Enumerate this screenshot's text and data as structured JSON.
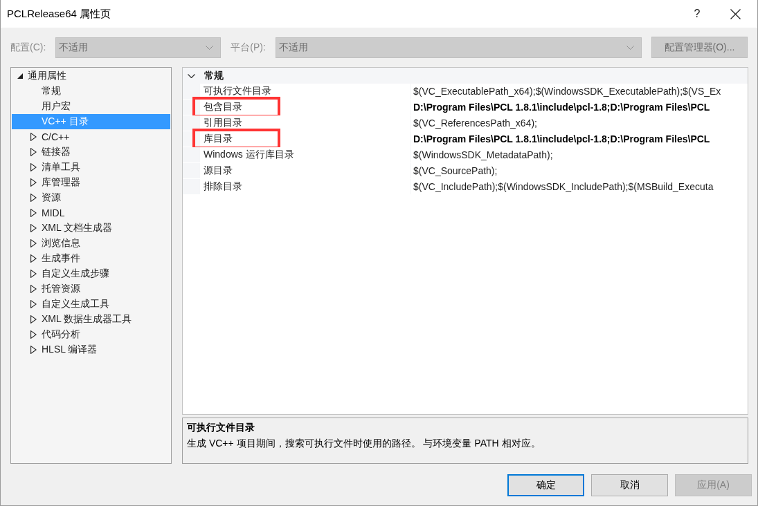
{
  "window": {
    "title": "PCLRelease64 属性页",
    "help_button": "?"
  },
  "config_bar": {
    "configuration": {
      "label": "配置(C):",
      "value": "不适用",
      "disabled": true
    },
    "platform": {
      "label": "平台(P):",
      "value": "不适用",
      "disabled": true
    },
    "manager_button": {
      "label": "配置管理器(O)...",
      "disabled": true
    }
  },
  "sidebar": {
    "items": [
      {
        "label": "通用属性",
        "expanded": true,
        "selected": false,
        "children": [
          {
            "label": "常规",
            "selected": false
          },
          {
            "label": "用户宏",
            "selected": false
          },
          {
            "label": "VC++ 目录",
            "selected": true
          }
        ]
      },
      {
        "label": "C/C++",
        "expanded": false,
        "selected": false
      },
      {
        "label": "链接器",
        "expanded": false,
        "selected": false
      },
      {
        "label": "清单工具",
        "expanded": false,
        "selected": false
      },
      {
        "label": "库管理器",
        "expanded": false,
        "selected": false
      },
      {
        "label": "资源",
        "expanded": false,
        "selected": false
      },
      {
        "label": "MIDL",
        "expanded": false,
        "selected": false
      },
      {
        "label": "XML 文档生成器",
        "expanded": false,
        "selected": false
      },
      {
        "label": "浏览信息",
        "expanded": false,
        "selected": false
      },
      {
        "label": "生成事件",
        "expanded": false,
        "selected": false
      },
      {
        "label": "自定义生成步骤",
        "expanded": false,
        "selected": false
      },
      {
        "label": "托管资源",
        "expanded": false,
        "selected": false
      },
      {
        "label": "自定义生成工具",
        "expanded": false,
        "selected": false
      },
      {
        "label": "XML 数据生成器工具",
        "expanded": false,
        "selected": false
      },
      {
        "label": "代码分析",
        "expanded": false,
        "selected": false
      },
      {
        "label": "HLSL 编译器",
        "expanded": false,
        "selected": false
      }
    ]
  },
  "property_grid": {
    "category": {
      "label": "常规",
      "expanded": true
    },
    "rows": [
      {
        "name": "可执行文件目录",
        "value": "$(VC_ExecutablePath_x64);$(WindowsSDK_ExecutablePath);$(VS_Ex",
        "modified": false,
        "highlighted": false
      },
      {
        "name": "包含目录",
        "value": "D:\\Program Files\\PCL 1.8.1\\include\\pcl-1.8;D:\\Program Files\\PCL",
        "modified": true,
        "highlighted": true
      },
      {
        "name": "引用目录",
        "value": "$(VC_ReferencesPath_x64);",
        "modified": false,
        "highlighted": false
      },
      {
        "name": "库目录",
        "value": "D:\\Program Files\\PCL 1.8.1\\include\\pcl-1.8;D:\\Program Files\\PCL",
        "modified": true,
        "highlighted": true
      },
      {
        "name": "Windows 运行库目录",
        "value": "$(WindowsSDK_MetadataPath);",
        "modified": false,
        "highlighted": false
      },
      {
        "name": "源目录",
        "value": "$(VC_SourcePath);",
        "modified": false,
        "highlighted": false
      },
      {
        "name": "排除目录",
        "value": "$(VC_IncludePath);$(WindowsSDK_IncludePath);$(MSBuild_Executa",
        "modified": false,
        "highlighted": false
      }
    ]
  },
  "description": {
    "title": "可执行文件目录",
    "text": "生成 VC++ 项目期间，搜索可执行文件时使用的路径。 与环境变量 PATH 相对应。"
  },
  "buttons": [
    {
      "label": "确定",
      "default": true,
      "disabled": false
    },
    {
      "label": "取消",
      "default": false,
      "disabled": false
    },
    {
      "label": "应用(A)",
      "default": false,
      "disabled": true
    }
  ]
}
